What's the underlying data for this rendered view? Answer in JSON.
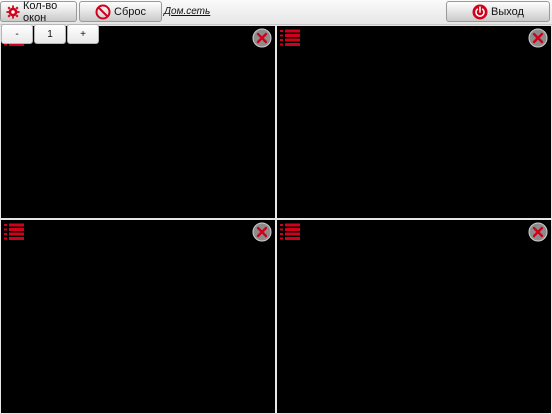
{
  "toolbar": {
    "windows_label": "Кол-во окон",
    "reset_label": "Сброс",
    "network_link": "Дом.сеть",
    "exit_label": "Выход"
  },
  "stepper": {
    "minus": "-",
    "value": "1",
    "plus": "+"
  },
  "colors": {
    "accent_red": "#d0021b",
    "cell_bg": "#000000"
  },
  "cells": [
    {
      "icons": [
        "menu-icon",
        "close-icon"
      ]
    },
    {
      "icons": [
        "menu-icon",
        "close-icon"
      ]
    },
    {
      "icons": [
        "menu-icon",
        "close-icon"
      ]
    },
    {
      "icons": [
        "menu-icon",
        "close-icon"
      ]
    }
  ]
}
